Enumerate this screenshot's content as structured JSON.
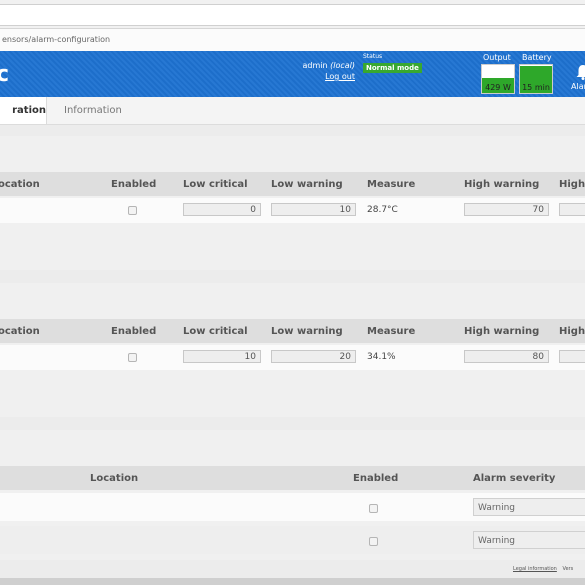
{
  "url": "ensors/alarm-configuration",
  "header": {
    "logo_text": "c",
    "user_name": "admin",
    "user_realm": "(local)",
    "logout_label": "Log out",
    "status_label": "Status",
    "status_value": "Normal mode",
    "output_label": "Output",
    "output_value": "429 W",
    "output_level": 0.55,
    "battery_label": "Battery",
    "battery_value": "15 min",
    "battery_level": 0.95,
    "alarms_label": "Alar",
    "brand_color": "#1e72d1",
    "status_color": "#38a830"
  },
  "tabs": [
    {
      "label": "ration",
      "active": true
    },
    {
      "label": "Information",
      "active": false
    }
  ],
  "temperature_table": {
    "headers": [
      "ocation",
      "Enabled",
      "Low critical",
      "Low warning",
      "Measure",
      "High warning",
      "High"
    ],
    "row": {
      "low_critical": "0",
      "low_warning": "10",
      "measure": "28.7°C",
      "high_warning": "70",
      "high": ""
    }
  },
  "humidity_table": {
    "headers": [
      "ocation",
      "Enabled",
      "Low critical",
      "Low warning",
      "Measure",
      "High warning",
      "High"
    ],
    "row": {
      "low_critical": "10",
      "low_warning": "20",
      "measure": "34.1%",
      "high_warning": "80",
      "high": ""
    }
  },
  "contact_table": {
    "headers": [
      "Location",
      "Enabled",
      "Alarm severity"
    ],
    "rows": [
      {
        "severity": "Warning"
      },
      {
        "severity": "Warning"
      }
    ]
  },
  "footer": {
    "legal": "Legal information",
    "version": "Vers"
  }
}
